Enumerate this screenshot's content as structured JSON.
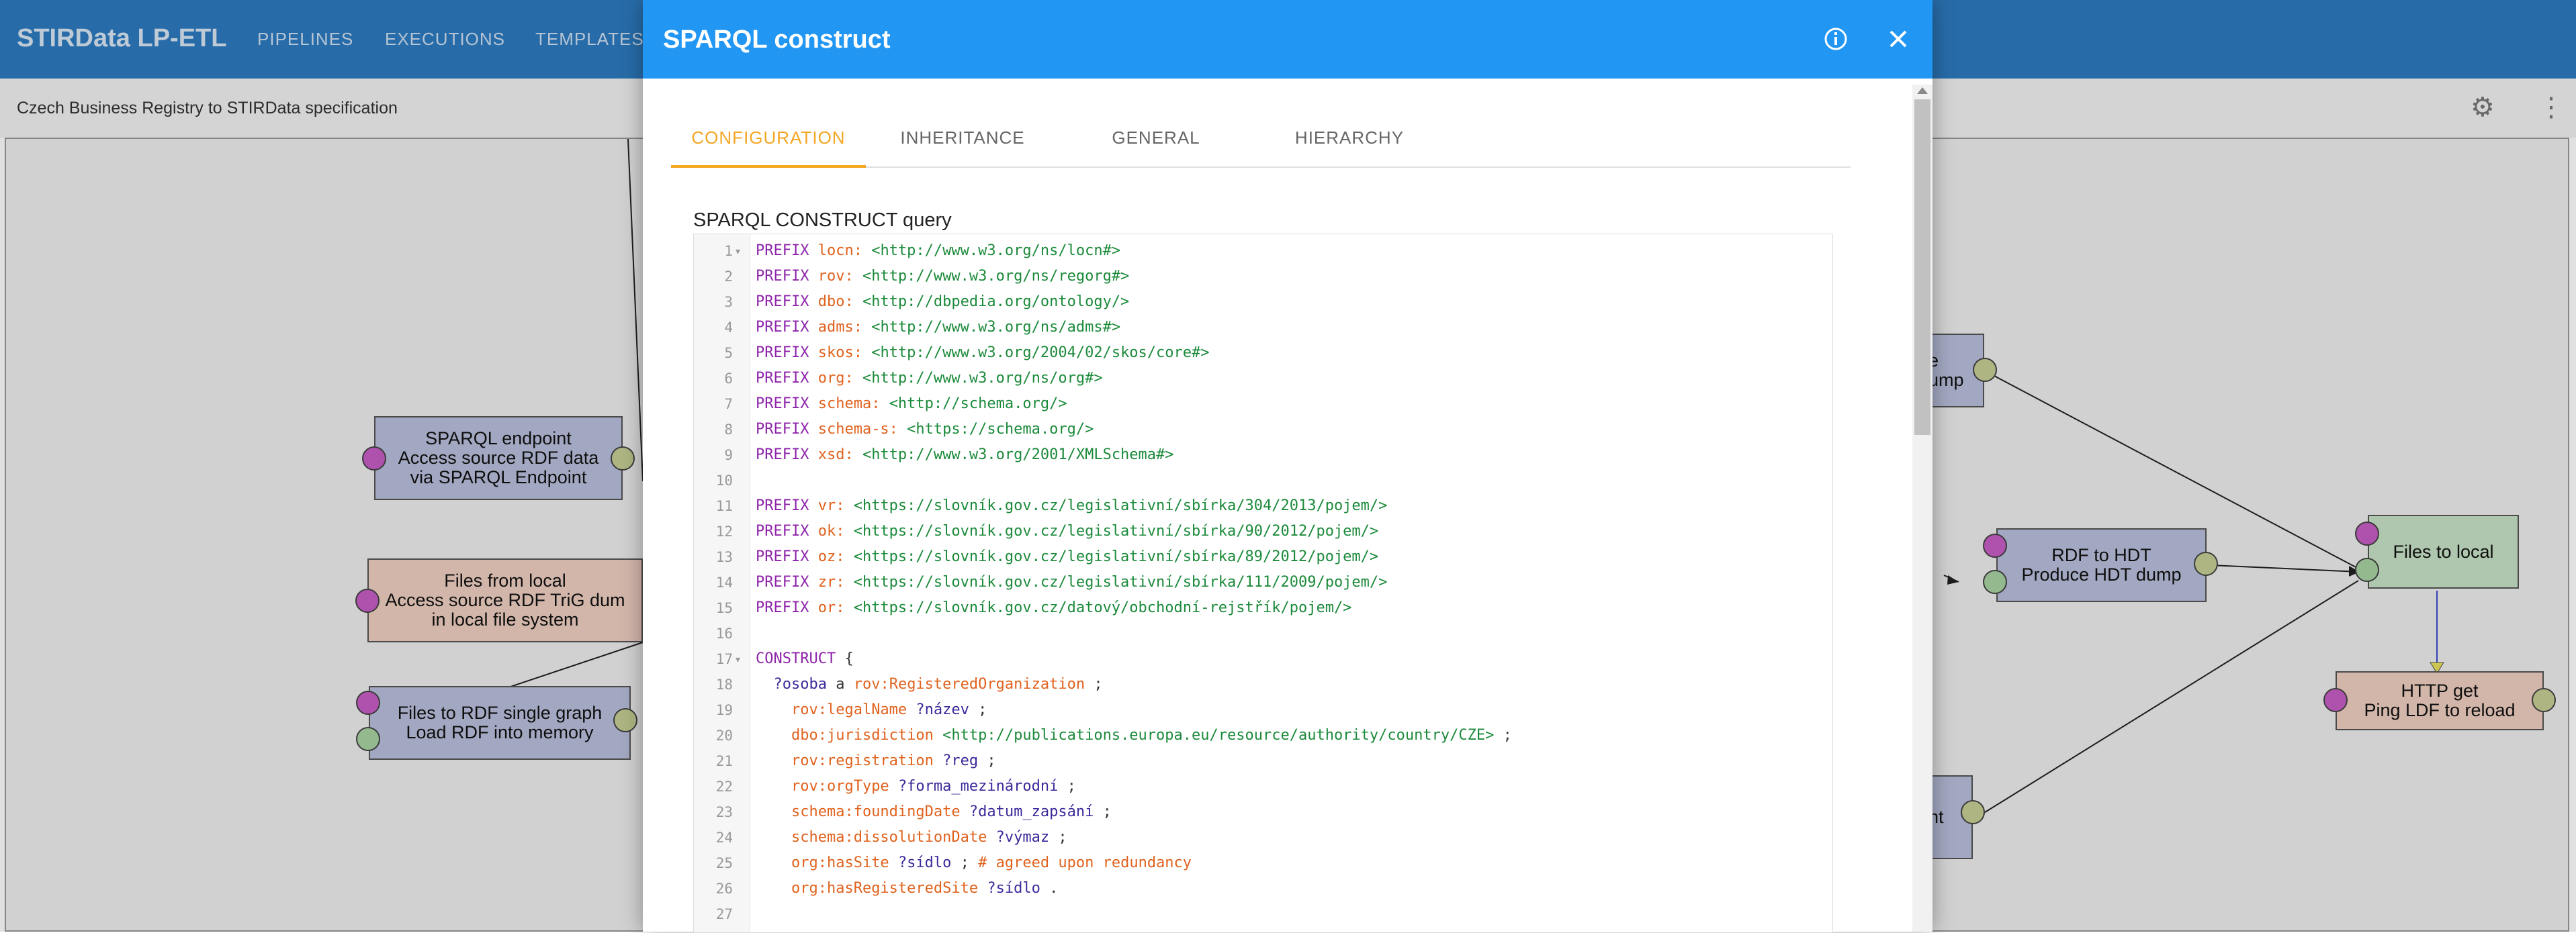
{
  "app": {
    "title": "STIRData LP-ETL",
    "nav": [
      "PIPELINES",
      "EXECUTIONS",
      "TEMPLATES"
    ]
  },
  "pipeline": {
    "name": "Czech Business Registry to STIRData specification"
  },
  "icons": {
    "settings": "gear-icon",
    "menu": "more-vert-icon",
    "info": "info-icon",
    "close": "close-icon"
  },
  "components": [
    {
      "lines": [
        "SPARQL endpoint",
        "Access source RDF data",
        "via SPARQL Endpoint"
      ]
    },
    {
      "lines": [
        "Files from local",
        "Access source RDF TriG dum",
        "in local file system"
      ]
    },
    {
      "lines": [
        "Files to RDF single graph",
        "Load RDF into memory"
      ]
    },
    {
      "lines": [
        "e",
        "ump"
      ]
    },
    {
      "lines": [
        "RDF to HDT",
        "Produce HDT dump"
      ]
    },
    {
      "lines": [
        "Files to local"
      ]
    },
    {
      "lines": [
        "HTTP get",
        "Ping LDF to reload"
      ]
    },
    {
      "lines": [
        "nt"
      ]
    }
  ],
  "dialog": {
    "title": "SPARQL construct",
    "tabs": [
      "CONFIGURATION",
      "INHERITANCE",
      "GENERAL",
      "HIERARCHY"
    ],
    "active_tab": "CONFIGURATION",
    "query_label": "SPARQL CONSTRUCT query"
  },
  "code_lines": [
    [
      [
        "kw",
        "PREFIX "
      ],
      [
        "pf",
        "locn: "
      ],
      [
        "ir",
        "<http://www.w3.org/ns/locn#>"
      ]
    ],
    [
      [
        "kw",
        "PREFIX "
      ],
      [
        "pf",
        "rov: "
      ],
      [
        "ir",
        "<http://www.w3.org/ns/regorg#>"
      ]
    ],
    [
      [
        "kw",
        "PREFIX "
      ],
      [
        "pf",
        "dbo: "
      ],
      [
        "ir",
        "<http://dbpedia.org/ontology/>"
      ]
    ],
    [
      [
        "kw",
        "PREFIX "
      ],
      [
        "pf",
        "adms: "
      ],
      [
        "ir",
        "<http://www.w3.org/ns/adms#>"
      ]
    ],
    [
      [
        "kw",
        "PREFIX "
      ],
      [
        "pf",
        "skos: "
      ],
      [
        "ir",
        "<http://www.w3.org/2004/02/skos/core#>"
      ]
    ],
    [
      [
        "kw",
        "PREFIX "
      ],
      [
        "pf",
        "org: "
      ],
      [
        "ir",
        "<http://www.w3.org/ns/org#>"
      ]
    ],
    [
      [
        "kw",
        "PREFIX "
      ],
      [
        "pf",
        "schema: "
      ],
      [
        "ir",
        "<http://schema.org/>"
      ]
    ],
    [
      [
        "kw",
        "PREFIX "
      ],
      [
        "pf",
        "schema-s: "
      ],
      [
        "ir",
        "<https://schema.org/>"
      ]
    ],
    [
      [
        "kw",
        "PREFIX "
      ],
      [
        "pf",
        "xsd: "
      ],
      [
        "ir",
        "<http://www.w3.org/2001/XMLSchema#>"
      ]
    ],
    [],
    [
      [
        "kw",
        "PREFIX "
      ],
      [
        "pf",
        "vr: "
      ],
      [
        "ir",
        "<https://slovník.gov.cz/legislativní/sbírka/304/2013/pojem/>"
      ]
    ],
    [
      [
        "kw",
        "PREFIX "
      ],
      [
        "pf",
        "ok: "
      ],
      [
        "ir",
        "<https://slovník.gov.cz/legislativní/sbírka/90/2012/pojem/>"
      ]
    ],
    [
      [
        "kw",
        "PREFIX "
      ],
      [
        "pf",
        "oz: "
      ],
      [
        "ir",
        "<https://slovník.gov.cz/legislativní/sbírka/89/2012/pojem/>"
      ]
    ],
    [
      [
        "kw",
        "PREFIX "
      ],
      [
        "pf",
        "zr: "
      ],
      [
        "ir",
        "<https://slovník.gov.cz/legislativní/sbírka/111/2009/pojem/>"
      ]
    ],
    [
      [
        "kw",
        "PREFIX "
      ],
      [
        "pf",
        "or: "
      ],
      [
        "ir",
        "<https://slovník.gov.cz/datový/obchodní-rejstřík/pojem/>"
      ]
    ],
    [],
    [
      [
        "kw",
        "CONSTRUCT "
      ],
      [
        "pl",
        "{"
      ]
    ],
    [
      [
        "pl",
        "  "
      ],
      [
        "vr",
        "?osoba "
      ],
      [
        "pl",
        "a "
      ],
      [
        "pf",
        "rov:RegisteredOrganization "
      ],
      [
        "pl",
        ";"
      ]
    ],
    [
      [
        "pl",
        "    "
      ],
      [
        "pf",
        "rov:legalName "
      ],
      [
        "vr",
        "?název "
      ],
      [
        "pl",
        ";"
      ]
    ],
    [
      [
        "pl",
        "    "
      ],
      [
        "pf",
        "dbo:jurisdiction "
      ],
      [
        "ir",
        "<http://publications.europa.eu/resource/authority/country/CZE> "
      ],
      [
        "pl",
        ";"
      ]
    ],
    [
      [
        "pl",
        "    "
      ],
      [
        "pf",
        "rov:registration "
      ],
      [
        "vr",
        "?reg "
      ],
      [
        "pl",
        ";"
      ]
    ],
    [
      [
        "pl",
        "    "
      ],
      [
        "pf",
        "rov:orgType "
      ],
      [
        "vr",
        "?forma_mezinárodní "
      ],
      [
        "pl",
        ";"
      ]
    ],
    [
      [
        "pl",
        "    "
      ],
      [
        "pf",
        "schema:foundingDate "
      ],
      [
        "vr",
        "?datum_zapsání "
      ],
      [
        "pl",
        ";"
      ]
    ],
    [
      [
        "pl",
        "    "
      ],
      [
        "pf",
        "schema:dissolutionDate "
      ],
      [
        "vr",
        "?výmaz "
      ],
      [
        "pl",
        ";"
      ]
    ],
    [
      [
        "pl",
        "    "
      ],
      [
        "pf",
        "org:hasSite "
      ],
      [
        "vr",
        "?sídlo "
      ],
      [
        "pl",
        "; "
      ],
      [
        "cm",
        "# agreed upon redundancy"
      ]
    ],
    [
      [
        "pl",
        "    "
      ],
      [
        "pf",
        "org:hasRegisteredSite "
      ],
      [
        "vr",
        "?sídlo "
      ],
      [
        "pl",
        "."
      ]
    ],
    []
  ],
  "fold_lines": [
    1,
    17
  ]
}
